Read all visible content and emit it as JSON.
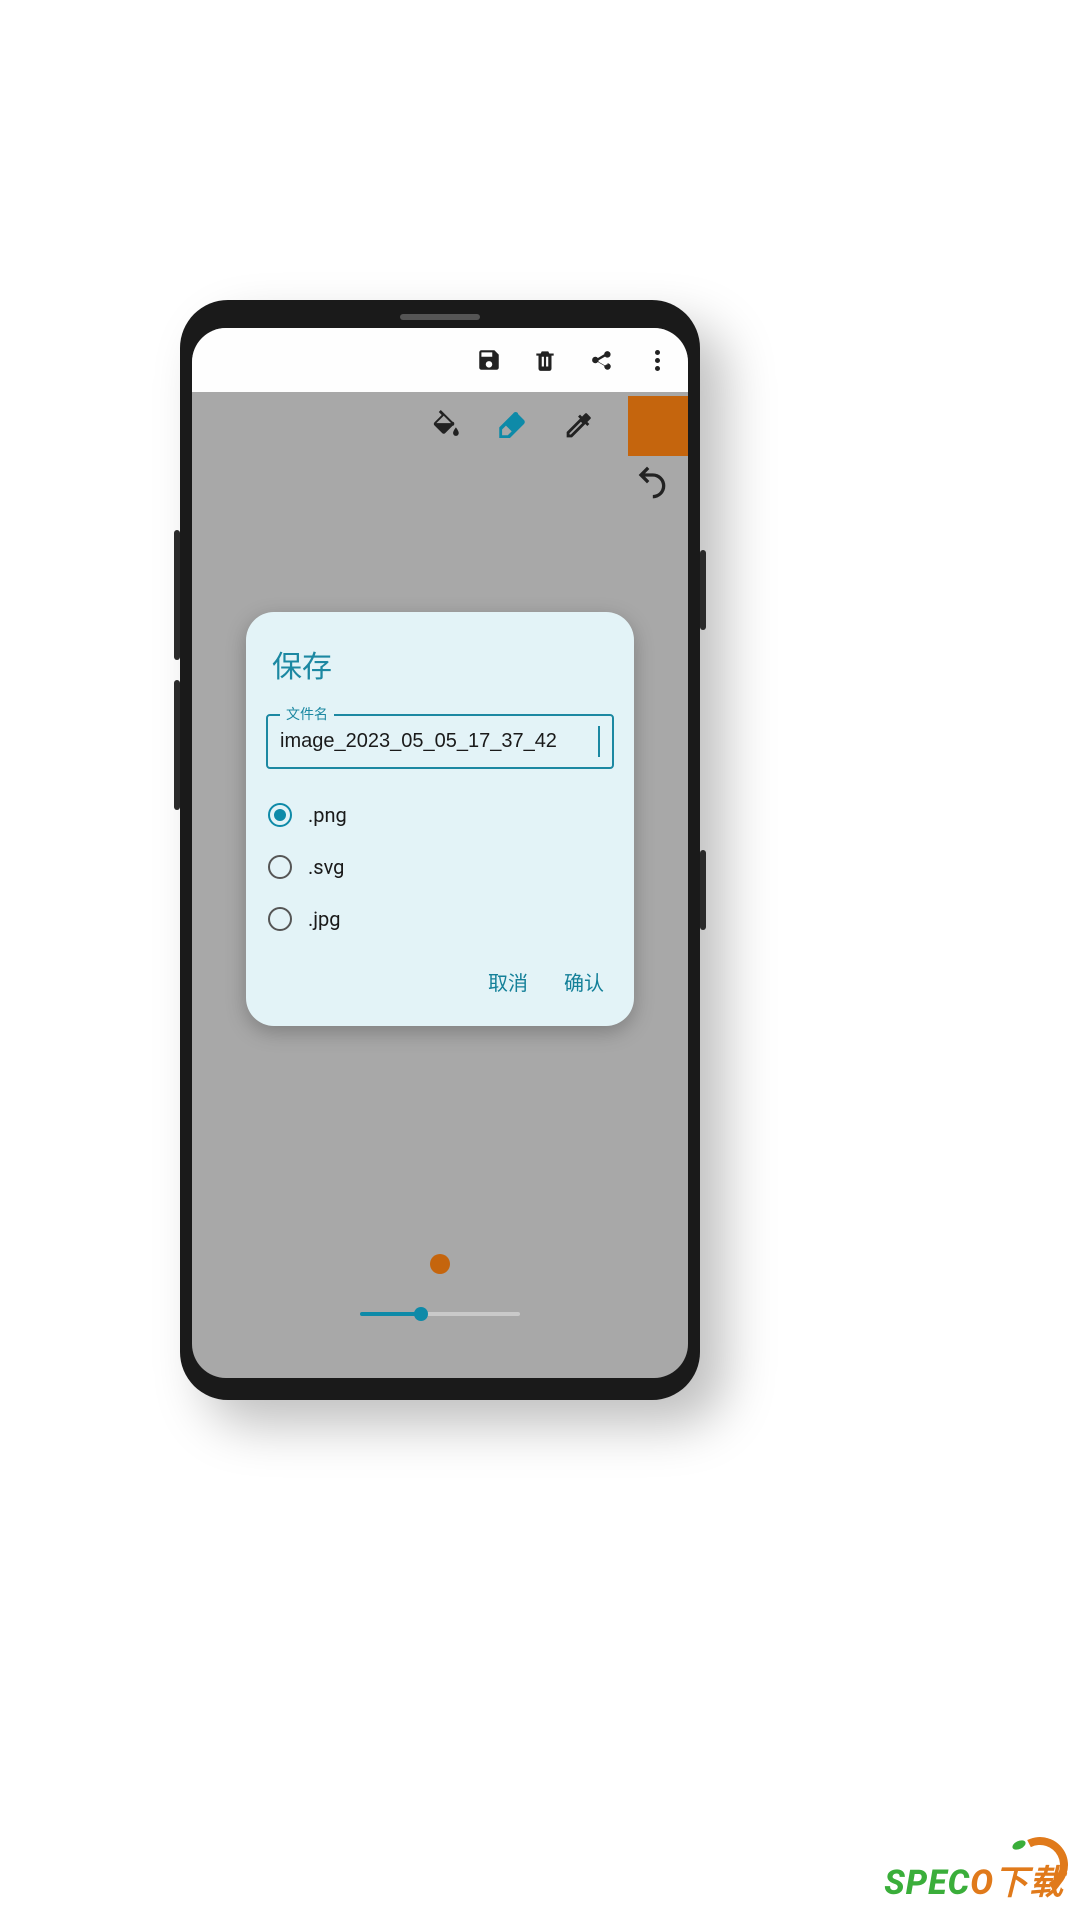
{
  "toolbar": {
    "tools": [
      "fill",
      "eraser",
      "eyedropper"
    ],
    "active_tool": "eraser",
    "color_hex": "#c5650d"
  },
  "dialog": {
    "title": "保存",
    "filename_label": "文件名",
    "filename_value": "image_2023_05_05_17_37_42",
    "formats": [
      {
        "ext": ".png",
        "selected": true
      },
      {
        "ext": ".svg",
        "selected": false
      },
      {
        "ext": ".jpg",
        "selected": false
      }
    ],
    "cancel_label": "取消",
    "confirm_label": "确认"
  },
  "brush": {
    "slider_percent": 38
  },
  "watermark": {
    "text_green": "SPEC",
    "text_orange": "O下载"
  }
}
